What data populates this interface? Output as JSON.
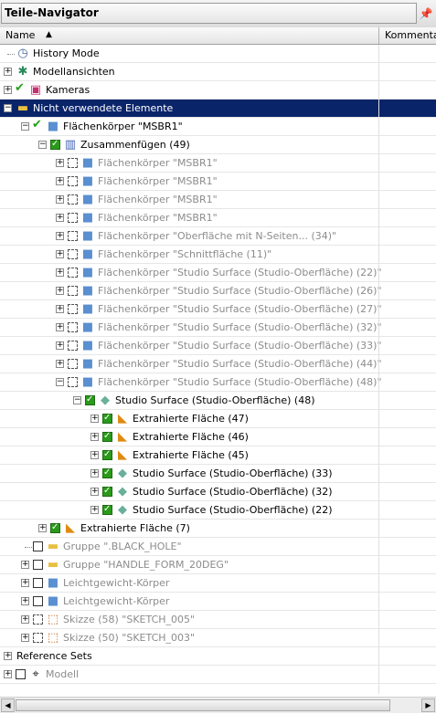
{
  "panel": {
    "title": "Teile-Navigator",
    "pin_icon": "pin-icon"
  },
  "columns": {
    "name": "Name",
    "comment": "Kommentar"
  },
  "tree": [
    {
      "label": "History Mode",
      "level": 0,
      "expander": "none",
      "check": "none",
      "icon": "clock-icon",
      "icon_glyph": "◷",
      "icon_color": "#4a6a9a",
      "gray": false
    },
    {
      "label": "Modellansichten",
      "level": 0,
      "expander": "plus",
      "check": "none",
      "icon": "views-icon",
      "icon_glyph": "✱",
      "icon_color": "#2a8a5a",
      "gray": false
    },
    {
      "label": "Kameras",
      "level": 0,
      "expander": "plus",
      "check": "tick",
      "icon": "camera-icon",
      "icon_glyph": "▣",
      "icon_color": "#c43070",
      "gray": false
    },
    {
      "label": "Nicht verwendete Elemente",
      "level": 0,
      "expander": "minus",
      "check": "none",
      "icon": "folder-icon",
      "icon_glyph": "▬",
      "icon_color": "#e8c040",
      "gray": false,
      "selected": true
    },
    {
      "label": "Flächenkörper \"MSBR1\"",
      "level": 1,
      "expander": "minus",
      "check": "tick-red",
      "icon": "body-icon",
      "icon_glyph": "■",
      "icon_color": "#5a8fd0",
      "gray": false
    },
    {
      "label": "Zusammenfügen (49)",
      "level": 2,
      "expander": "minus",
      "check": "on",
      "icon": "unite-icon",
      "icon_glyph": "▥",
      "icon_color": "#4060b0",
      "gray": false
    },
    {
      "label": "Flächenkörper \"MSBR1\"",
      "level": 3,
      "expander": "plus",
      "check": "dash",
      "icon": "body-icon",
      "icon_glyph": "■",
      "icon_color": "#5a8fd0",
      "gray": true
    },
    {
      "label": "Flächenkörper \"MSBR1\"",
      "level": 3,
      "expander": "plus",
      "check": "dash",
      "icon": "body-icon",
      "icon_glyph": "■",
      "icon_color": "#5a8fd0",
      "gray": true
    },
    {
      "label": "Flächenkörper \"MSBR1\"",
      "level": 3,
      "expander": "plus",
      "check": "dash",
      "icon": "body-icon",
      "icon_glyph": "■",
      "icon_color": "#5a8fd0",
      "gray": true
    },
    {
      "label": "Flächenkörper \"MSBR1\"",
      "level": 3,
      "expander": "plus",
      "check": "dash",
      "icon": "body-icon",
      "icon_glyph": "■",
      "icon_color": "#5a8fd0",
      "gray": true
    },
    {
      "label": "Flächenkörper \"Oberfläche mit N-Seiten... (34)\"",
      "level": 3,
      "expander": "plus",
      "check": "dash",
      "icon": "body-icon",
      "icon_glyph": "■",
      "icon_color": "#5a8fd0",
      "gray": true
    },
    {
      "label": "Flächenkörper \"Schnittfläche (11)\"",
      "level": 3,
      "expander": "plus",
      "check": "dash",
      "icon": "body-icon",
      "icon_glyph": "■",
      "icon_color": "#5a8fd0",
      "gray": true
    },
    {
      "label": "Flächenkörper \"Studio Surface (Studio-Oberfläche) (22)\"",
      "level": 3,
      "expander": "plus",
      "check": "dash",
      "icon": "body-icon",
      "icon_glyph": "■",
      "icon_color": "#5a8fd0",
      "gray": true
    },
    {
      "label": "Flächenkörper \"Studio Surface (Studio-Oberfläche) (26)\"",
      "level": 3,
      "expander": "plus",
      "check": "dash",
      "icon": "body-icon",
      "icon_glyph": "■",
      "icon_color": "#5a8fd0",
      "gray": true
    },
    {
      "label": "Flächenkörper \"Studio Surface (Studio-Oberfläche) (27)\"",
      "level": 3,
      "expander": "plus",
      "check": "dash",
      "icon": "body-icon",
      "icon_glyph": "■",
      "icon_color": "#5a8fd0",
      "gray": true
    },
    {
      "label": "Flächenkörper \"Studio Surface (Studio-Oberfläche) (32)\"",
      "level": 3,
      "expander": "plus",
      "check": "dash",
      "icon": "body-icon",
      "icon_glyph": "■",
      "icon_color": "#5a8fd0",
      "gray": true
    },
    {
      "label": "Flächenkörper \"Studio Surface (Studio-Oberfläche) (33)\"",
      "level": 3,
      "expander": "plus",
      "check": "dash",
      "icon": "body-icon",
      "icon_glyph": "■",
      "icon_color": "#5a8fd0",
      "gray": true
    },
    {
      "label": "Flächenkörper \"Studio Surface (Studio-Oberfläche) (44)\"",
      "level": 3,
      "expander": "plus",
      "check": "dash",
      "icon": "body-icon",
      "icon_glyph": "■",
      "icon_color": "#5a8fd0",
      "gray": true
    },
    {
      "label": "Flächenkörper \"Studio Surface (Studio-Oberfläche) (48)\"",
      "level": 3,
      "expander": "minus",
      "check": "dash",
      "icon": "body-icon",
      "icon_glyph": "■",
      "icon_color": "#5a8fd0",
      "gray": true
    },
    {
      "label": "Studio Surface (Studio-Oberfläche) (48)",
      "level": 4,
      "expander": "minus",
      "check": "on",
      "icon": "studio-surface-icon",
      "icon_glyph": "◆",
      "icon_color": "#6ab09a",
      "gray": false
    },
    {
      "label": "Extrahierte Fläche (47)",
      "level": 5,
      "expander": "plus",
      "check": "on",
      "icon": "extract-face-icon",
      "icon_glyph": "◣",
      "icon_color": "#e08a10",
      "gray": false
    },
    {
      "label": "Extrahierte Fläche (46)",
      "level": 5,
      "expander": "plus",
      "check": "on",
      "icon": "extract-face-icon",
      "icon_glyph": "◣",
      "icon_color": "#e08a10",
      "gray": false
    },
    {
      "label": "Extrahierte Fläche (45)",
      "level": 5,
      "expander": "plus",
      "check": "on",
      "icon": "extract-face-icon",
      "icon_glyph": "◣",
      "icon_color": "#e08a10",
      "gray": false
    },
    {
      "label": "Studio Surface (Studio-Oberfläche) (33)",
      "level": 5,
      "expander": "plus",
      "check": "on",
      "icon": "studio-surface-icon",
      "icon_glyph": "◆",
      "icon_color": "#6ab09a",
      "gray": false
    },
    {
      "label": "Studio Surface (Studio-Oberfläche) (32)",
      "level": 5,
      "expander": "plus",
      "check": "on",
      "icon": "studio-surface-icon",
      "icon_glyph": "◆",
      "icon_color": "#6ab09a",
      "gray": false
    },
    {
      "label": "Studio Surface (Studio-Oberfläche) (22)",
      "level": 5,
      "expander": "plus",
      "check": "on",
      "icon": "studio-surface-icon",
      "icon_glyph": "◆",
      "icon_color": "#6ab09a",
      "gray": false
    },
    {
      "label": "Extrahierte Fläche (7)",
      "level": 2,
      "expander": "plus",
      "check": "on",
      "icon": "extract-face-icon",
      "icon_glyph": "◣",
      "icon_color": "#e08a10",
      "gray": false
    },
    {
      "label": "Gruppe \".BLACK_HOLE\"",
      "level": 1,
      "expander": "none",
      "check": "box",
      "icon": "group-folder-icon",
      "icon_glyph": "▬",
      "icon_color": "#e8c040",
      "gray": true
    },
    {
      "label": "Gruppe \"HANDLE_FORM_20DEG\"",
      "level": 1,
      "expander": "plus",
      "check": "box",
      "icon": "group-folder-icon",
      "icon_glyph": "▬",
      "icon_color": "#e8c040",
      "gray": true
    },
    {
      "label": "Leichtgewicht-Körper",
      "level": 1,
      "expander": "plus",
      "check": "box",
      "icon": "body-icon",
      "icon_glyph": "■",
      "icon_color": "#5a8fd0",
      "gray": true
    },
    {
      "label": "Leichtgewicht-Körper",
      "level": 1,
      "expander": "plus",
      "check": "box",
      "icon": "body-icon",
      "icon_glyph": "■",
      "icon_color": "#5a8fd0",
      "gray": true
    },
    {
      "label": "Skizze (58) \"SKETCH_005\"",
      "level": 1,
      "expander": "plus",
      "check": "dash",
      "icon": "sketch-icon",
      "icon_glyph": "⬚",
      "icon_color": "#c06010",
      "gray": true
    },
    {
      "label": "Skizze (50) \"SKETCH_003\"",
      "level": 1,
      "expander": "plus",
      "check": "dash",
      "icon": "sketch-icon",
      "icon_glyph": "⬚",
      "icon_color": "#c06010",
      "gray": true
    },
    {
      "label": "Reference Sets",
      "level": 0,
      "expander": "plus",
      "check": "none",
      "icon": "",
      "icon_glyph": "",
      "icon_color": "#000",
      "gray": false
    },
    {
      "label": "Modell",
      "level": 0,
      "expander": "plus",
      "check": "box",
      "icon": "model-icon",
      "icon_glyph": "⌖",
      "icon_color": "#202020",
      "gray": true
    }
  ]
}
